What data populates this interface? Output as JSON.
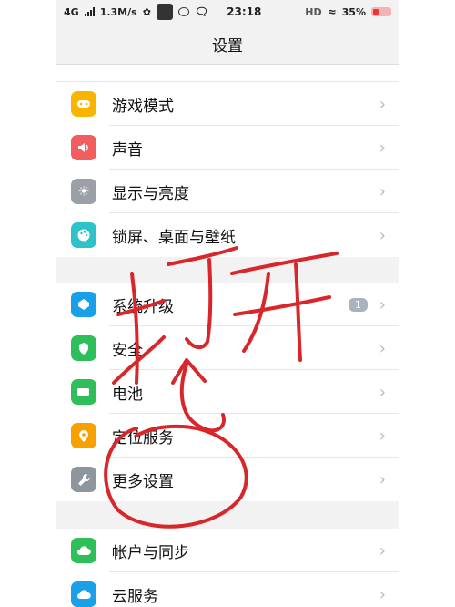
{
  "status_bar": {
    "network": "4G",
    "speed": "1.3M/s",
    "time": "23:18",
    "hd": "HD",
    "battery": "35%"
  },
  "header": {
    "title": "设置"
  },
  "groups": [
    {
      "items": [
        {
          "label": "游戏模式",
          "icon": "gamepad-icon",
          "color": "#f7b500"
        },
        {
          "label": "声音",
          "icon": "speaker-icon",
          "color": "#f25e5e"
        },
        {
          "label": "显示与亮度",
          "icon": "sun-icon",
          "color": "#9aa0a6"
        },
        {
          "label": "锁屏、桌面与壁纸",
          "icon": "palette-icon",
          "color": "#2cc3c9"
        }
      ]
    },
    {
      "items": [
        {
          "label": "系统升级",
          "icon": "upgrade-icon",
          "color": "#1aa0e8",
          "badge": "1"
        },
        {
          "label": "安全",
          "icon": "shield-icon",
          "color": "#2fbf5a"
        },
        {
          "label": "电池",
          "icon": "battery-icon",
          "color": "#2fbf5a"
        },
        {
          "label": "定位服务",
          "icon": "location-icon",
          "color": "#f7a000"
        },
        {
          "label": "更多设置",
          "icon": "wrench-icon",
          "color": "#8e959c"
        }
      ]
    },
    {
      "items": [
        {
          "label": "帐户与同步",
          "icon": "account-sync-icon",
          "color": "#2fbf5a"
        },
        {
          "label": "云服务",
          "icon": "cloud-icon",
          "color": "#1aa0e8"
        }
      ]
    }
  ],
  "annotation": {
    "text": "打开",
    "color": "#d8262a"
  }
}
